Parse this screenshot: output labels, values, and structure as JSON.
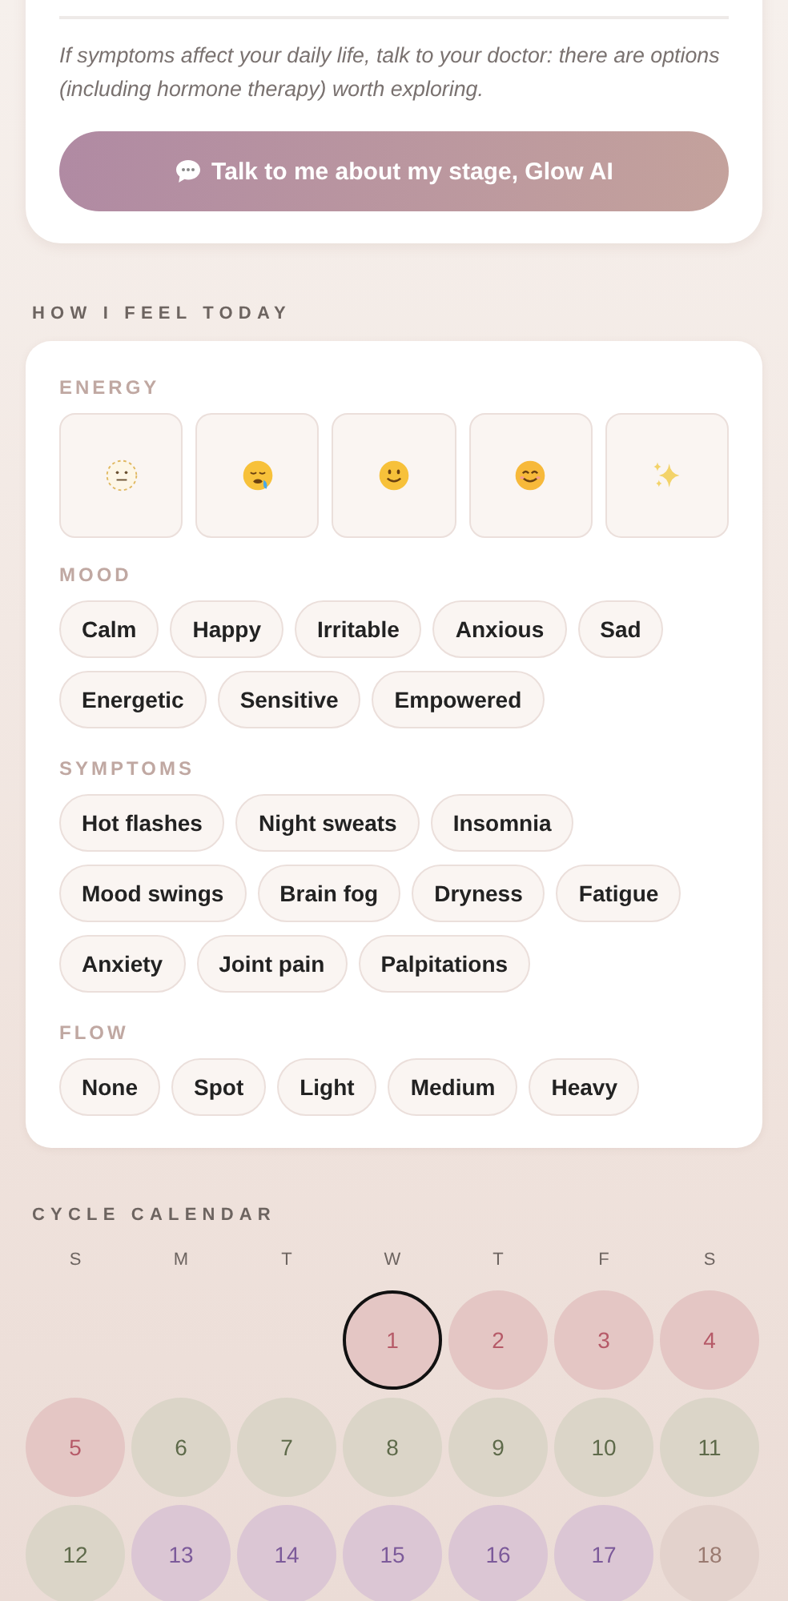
{
  "stage_card": {
    "note": "If symptoms affect your daily life, talk to your doctor: there are options (including hormone therapy) worth exploring.",
    "button": "Talk to me about my stage, Glow AI"
  },
  "feel_today": {
    "title": "HOW I FEEL TODAY",
    "energy": {
      "label": "ENERGY",
      "options": [
        {
          "kind": "flat",
          "selected": false
        },
        {
          "kind": "drained",
          "selected": false
        },
        {
          "kind": "smile",
          "selected": false
        },
        {
          "kind": "happy",
          "selected": false
        },
        {
          "kind": "sparkle",
          "selected": false
        }
      ]
    },
    "groups": [
      {
        "label": "MOOD",
        "chips": [
          {
            "label": "Calm",
            "selected": false
          },
          {
            "label": "Happy",
            "selected": false
          },
          {
            "label": "Irritable",
            "selected": false
          },
          {
            "label": "Anxious",
            "selected": false
          },
          {
            "label": "Sad",
            "selected": false
          },
          {
            "label": "Energetic",
            "selected": false
          },
          {
            "label": "Sensitive",
            "selected": false
          },
          {
            "label": "Empowered",
            "selected": false
          }
        ]
      },
      {
        "label": "SYMPTOMS",
        "chips": [
          {
            "label": "Hot flashes",
            "selected": false
          },
          {
            "label": "Night sweats",
            "selected": false
          },
          {
            "label": "Insomnia",
            "selected": false
          },
          {
            "label": "Mood swings",
            "selected": false
          },
          {
            "label": "Brain fog",
            "selected": false
          },
          {
            "label": "Dryness",
            "selected": false
          },
          {
            "label": "Fatigue",
            "selected": false
          },
          {
            "label": "Anxiety",
            "selected": false
          },
          {
            "label": "Joint pain",
            "selected": false
          },
          {
            "label": "Palpitations",
            "selected": false
          }
        ]
      },
      {
        "label": "FLOW",
        "chips": [
          {
            "label": "None",
            "selected": false
          },
          {
            "label": "Spot",
            "selected": false
          },
          {
            "label": "Light",
            "selected": false
          },
          {
            "label": "Medium",
            "selected": false
          },
          {
            "label": "Heavy",
            "selected": false
          }
        ]
      }
    ]
  },
  "calendar": {
    "title": "CYCLE CALENDAR",
    "weekdays": [
      "S",
      "M",
      "T",
      "W",
      "T",
      "F",
      "S"
    ],
    "days": [
      {
        "label": "1",
        "kind": "menstrual",
        "today": true
      },
      {
        "label": "2",
        "kind": "menstrual",
        "today": false
      },
      {
        "label": "3",
        "kind": "menstrual",
        "today": false
      },
      {
        "label": "4",
        "kind": "menstrual",
        "today": false
      },
      {
        "label": "5",
        "kind": "menstrual",
        "today": false
      },
      {
        "label": "6",
        "kind": "follicular",
        "today": false
      },
      {
        "label": "7",
        "kind": "follicular",
        "today": false
      },
      {
        "label": "8",
        "kind": "follicular",
        "today": false
      },
      {
        "label": "9",
        "kind": "follicular",
        "today": false
      },
      {
        "label": "10",
        "kind": "follicular",
        "today": false
      },
      {
        "label": "11",
        "kind": "follicular",
        "today": false
      },
      {
        "label": "12",
        "kind": "follicular",
        "today": false
      },
      {
        "label": "13",
        "kind": "fertile",
        "today": false
      },
      {
        "label": "14",
        "kind": "fertile",
        "today": false
      },
      {
        "label": "15",
        "kind": "fertile",
        "today": false
      },
      {
        "label": "16",
        "kind": "fertile",
        "today": false
      },
      {
        "label": "17",
        "kind": "fertile",
        "today": false
      },
      {
        "label": "18",
        "kind": "luteal",
        "today": false
      }
    ]
  }
}
